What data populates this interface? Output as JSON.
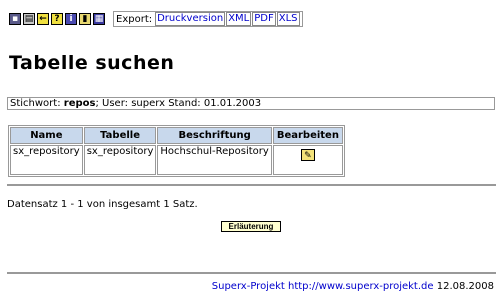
{
  "toolbar": {
    "icons": [
      "save-icon",
      "print-icon",
      "back-icon",
      "help-icon",
      "info-icon",
      "document-icon",
      "table-icon"
    ],
    "export_label": "Export:",
    "export_links": [
      "Druckversion",
      "XML",
      "PDF",
      "XLS"
    ]
  },
  "page": {
    "title": "Tabelle suchen"
  },
  "infobar": {
    "stichwort_label": "Stichwort:",
    "stichwort_value": "repos",
    "user_text": "; User: superx",
    "stand_text": "Stand: 01.01.2003"
  },
  "table": {
    "headers": [
      "Name",
      "Tabelle",
      "Beschriftung",
      "Bearbeiten"
    ],
    "rows": [
      {
        "name": "sx_repository",
        "tabelle": "sx_repository",
        "beschriftung": "Hochschul-Repository"
      }
    ]
  },
  "record_count": "Datensatz 1 - 1 von insgesamt 1 Satz.",
  "erlaeuterung_label": "Erläuterung",
  "footer": {
    "link_text": "Superx-Projekt http://www.superx-projekt.de",
    "date": "12.08.2008"
  },
  "colors": {
    "header_bg": "#c8d8ec",
    "link": "#0000cc",
    "button_bg": "#ffffd0"
  }
}
